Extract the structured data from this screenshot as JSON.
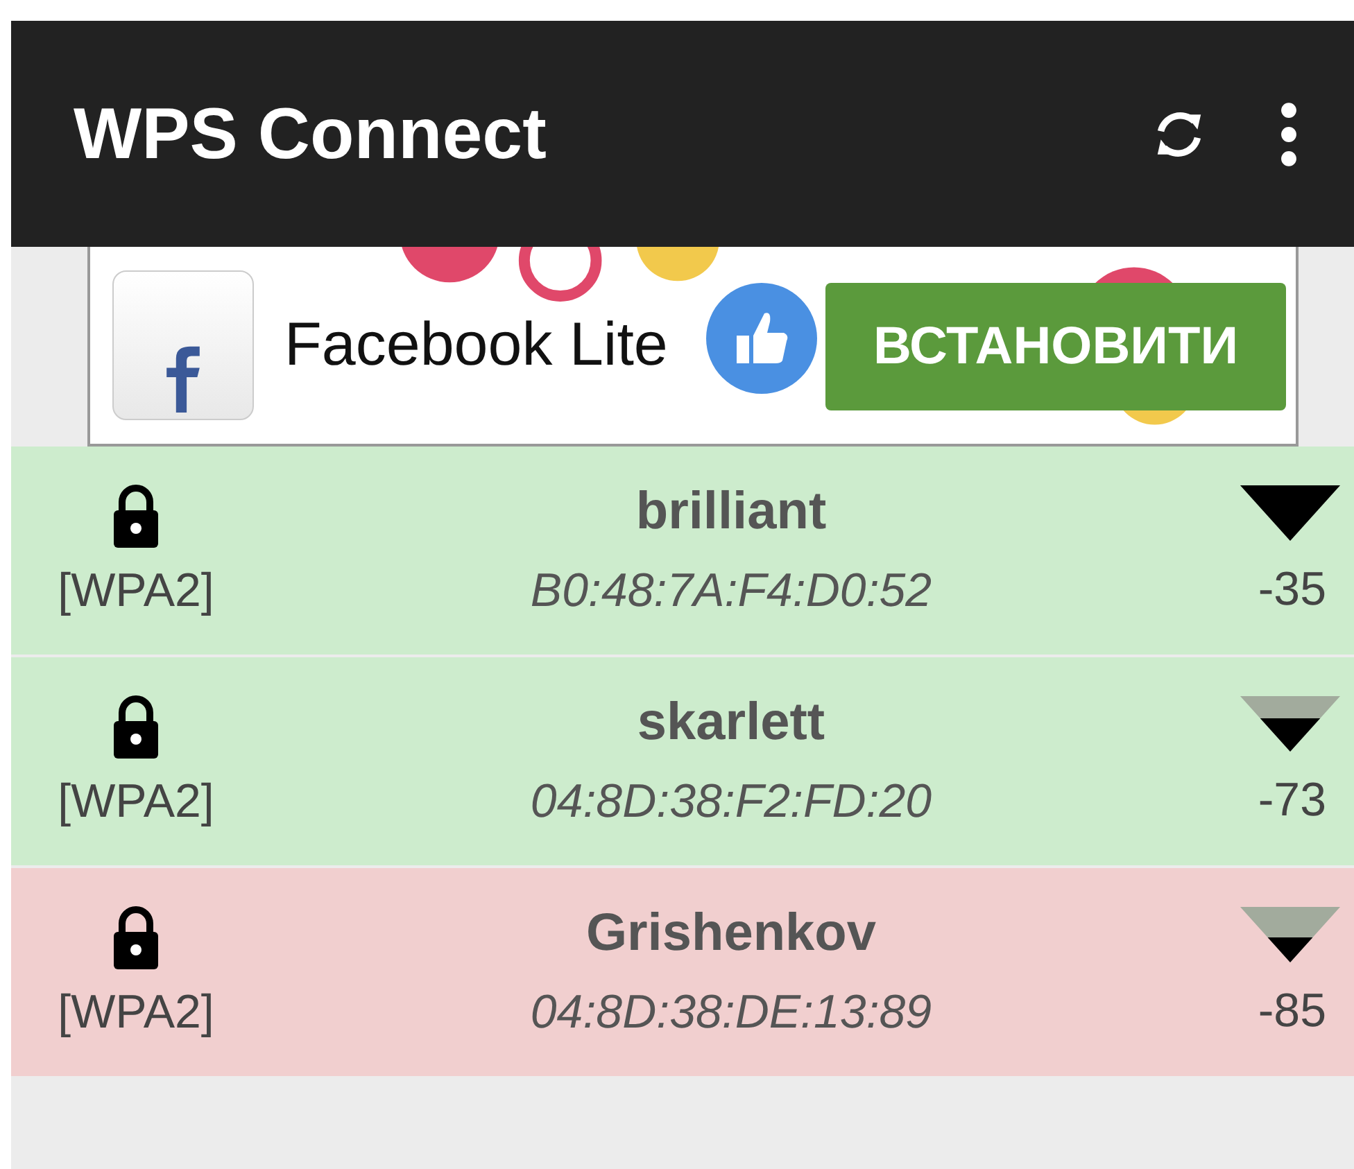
{
  "app_bar": {
    "title": "WPS Connect"
  },
  "ad": {
    "app_name": "Facebook Lite",
    "install_button": "ВСТАНОВИТИ"
  },
  "networks": [
    {
      "kind": "full",
      "security": "[WPA2]",
      "ssid": "brilliant",
      "bssid": "B0:48:7A:F4:D0:52",
      "signal": "-35",
      "color": "#cdeccd"
    },
    {
      "kind": "good",
      "security": "[WPA2]",
      "ssid": "skarlett",
      "bssid": "04:8D:38:F2:FD:20",
      "signal": "-73",
      "color": "#cdeccd"
    },
    {
      "kind": "fair",
      "security": "[WPA2]",
      "ssid": "Grishenkov",
      "bssid": "04:8D:38:DE:13:89",
      "signal": "-85",
      "color": "#f1cfcf"
    }
  ]
}
